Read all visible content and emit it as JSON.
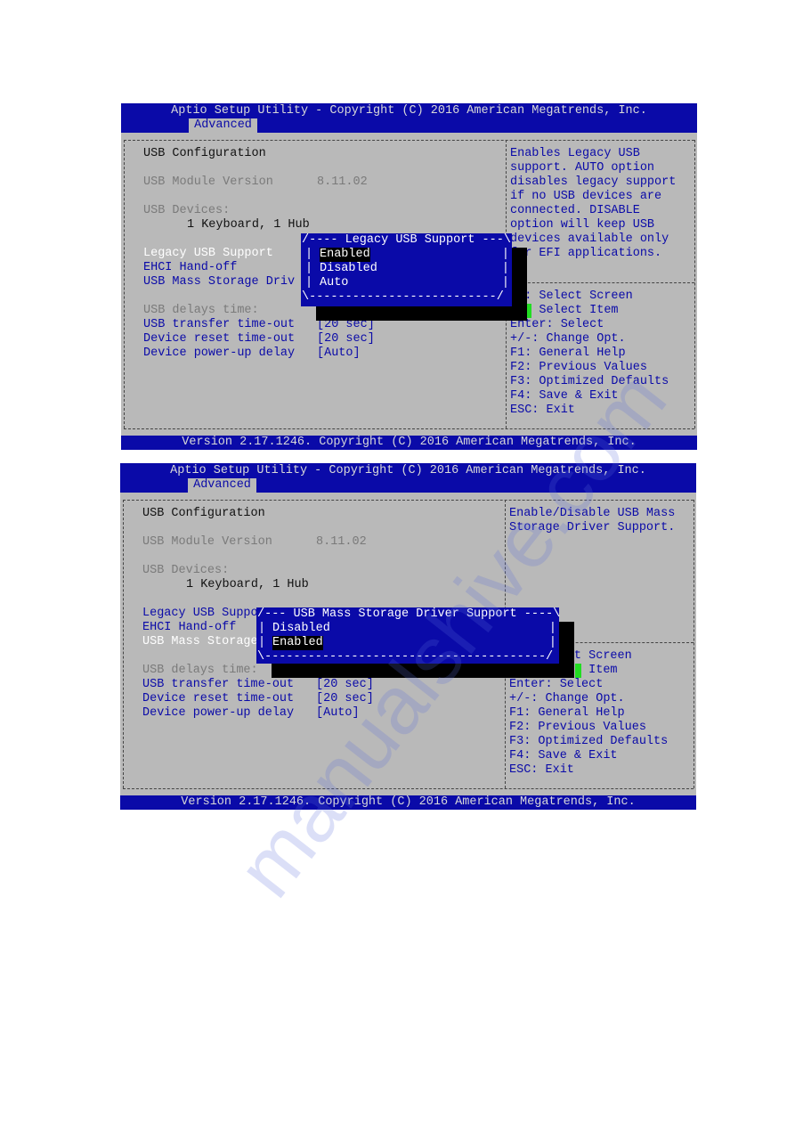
{
  "screens": [
    {
      "title": "Aptio Setup Utility - Copyright (C) 2016 American Megatrends, Inc.",
      "tab": "Advanced",
      "footer": "Version 2.17.1246. Copyright (C) 2016 American Megatrends, Inc.",
      "rows": [
        {
          "label": "USB Configuration",
          "kind": "heading"
        },
        {},
        {
          "label": "USB Module Version",
          "value": "8.11.02",
          "kind": "info"
        },
        {},
        {
          "label": "USB Devices:",
          "kind": "info"
        },
        {
          "label": "1 Keyboard, 1 Hub",
          "kind": "sub"
        },
        {},
        {
          "label": "Legacy USB Support",
          "kind": "selected"
        },
        {
          "label": "EHCI Hand-off",
          "kind": "option"
        },
        {
          "label": "USB Mass Storage Driv",
          "kind": "option"
        },
        {},
        {
          "label": "USB delays time:",
          "kind": "info"
        },
        {
          "label": "USB transfer time-out",
          "value": "[20 sec]",
          "kind": "option"
        },
        {
          "label": "Device reset time-out",
          "value": "[20 sec]",
          "kind": "option"
        },
        {
          "label": "Device power-up delay",
          "value": "[Auto]",
          "kind": "option"
        }
      ],
      "help": [
        "Enables Legacy USB",
        "support. AUTO option",
        "disables legacy support",
        "if no USB devices are",
        "connected. DISABLE",
        "option will keep USB",
        "devices available only",
        "for EFI applications."
      ],
      "keys": [
        "→←: Select Screen",
        "↑↓: Select Item",
        "Enter: Select",
        "+/-: Change Opt.",
        "F1: General Help",
        "F2: Previous Values",
        "F3: Optimized Defaults",
        "F4: Save & Exit",
        "ESC: Exit"
      ],
      "popup": {
        "title": "Legacy USB Support",
        "options": [
          "Enabled",
          "Disabled",
          "Auto"
        ],
        "selected": "Enabled"
      }
    },
    {
      "title": "Aptio Setup Utility - Copyright (C) 2016 American Megatrends, Inc.",
      "tab": "Advanced",
      "footer": "Version 2.17.1246. Copyright (C) 2016 American Megatrends, Inc.",
      "rows": [
        {
          "label": "USB Configuration",
          "kind": "heading"
        },
        {},
        {
          "label": "USB Module Version",
          "value": "8.11.02",
          "kind": "info"
        },
        {},
        {
          "label": "USB Devices:",
          "kind": "info"
        },
        {
          "label": "1 Keyboard, 1 Hub",
          "kind": "sub"
        },
        {},
        {
          "label": "Legacy USB Suppo",
          "kind": "option"
        },
        {
          "label": "EHCI Hand-off",
          "kind": "option"
        },
        {
          "label": "USB Mass Storage",
          "kind": "selected"
        },
        {},
        {
          "label": "USB delays time:",
          "kind": "info"
        },
        {
          "label": "USB transfer time-out",
          "value": "[20 sec]",
          "kind": "option"
        },
        {
          "label": "Device reset time-out",
          "value": "[20 sec]",
          "kind": "option"
        },
        {
          "label": "Device power-up delay",
          "value": "[Auto]",
          "kind": "option"
        }
      ],
      "help": [
        "Enable/Disable USB Mass",
        "Storage Driver Support."
      ],
      "keys": [
        "→←: Select Screen",
        "↑↓: Select Item",
        "Enter: Select",
        "+/-: Change Opt.",
        "F1: General Help",
        "F2: Previous Values",
        "F3: Optimized Defaults",
        "F4: Save & Exit",
        "ESC: Exit"
      ],
      "popup": {
        "title": "USB Mass Storage Driver Support",
        "options": [
          "Disabled",
          "Enabled"
        ],
        "selected": "Enabled"
      }
    }
  ],
  "watermark": "manualshive.com",
  "colors": {
    "bios_blue": "#0a0aa8",
    "bios_gray": "#b9b9b9",
    "cursor_green": "#22dd22"
  }
}
